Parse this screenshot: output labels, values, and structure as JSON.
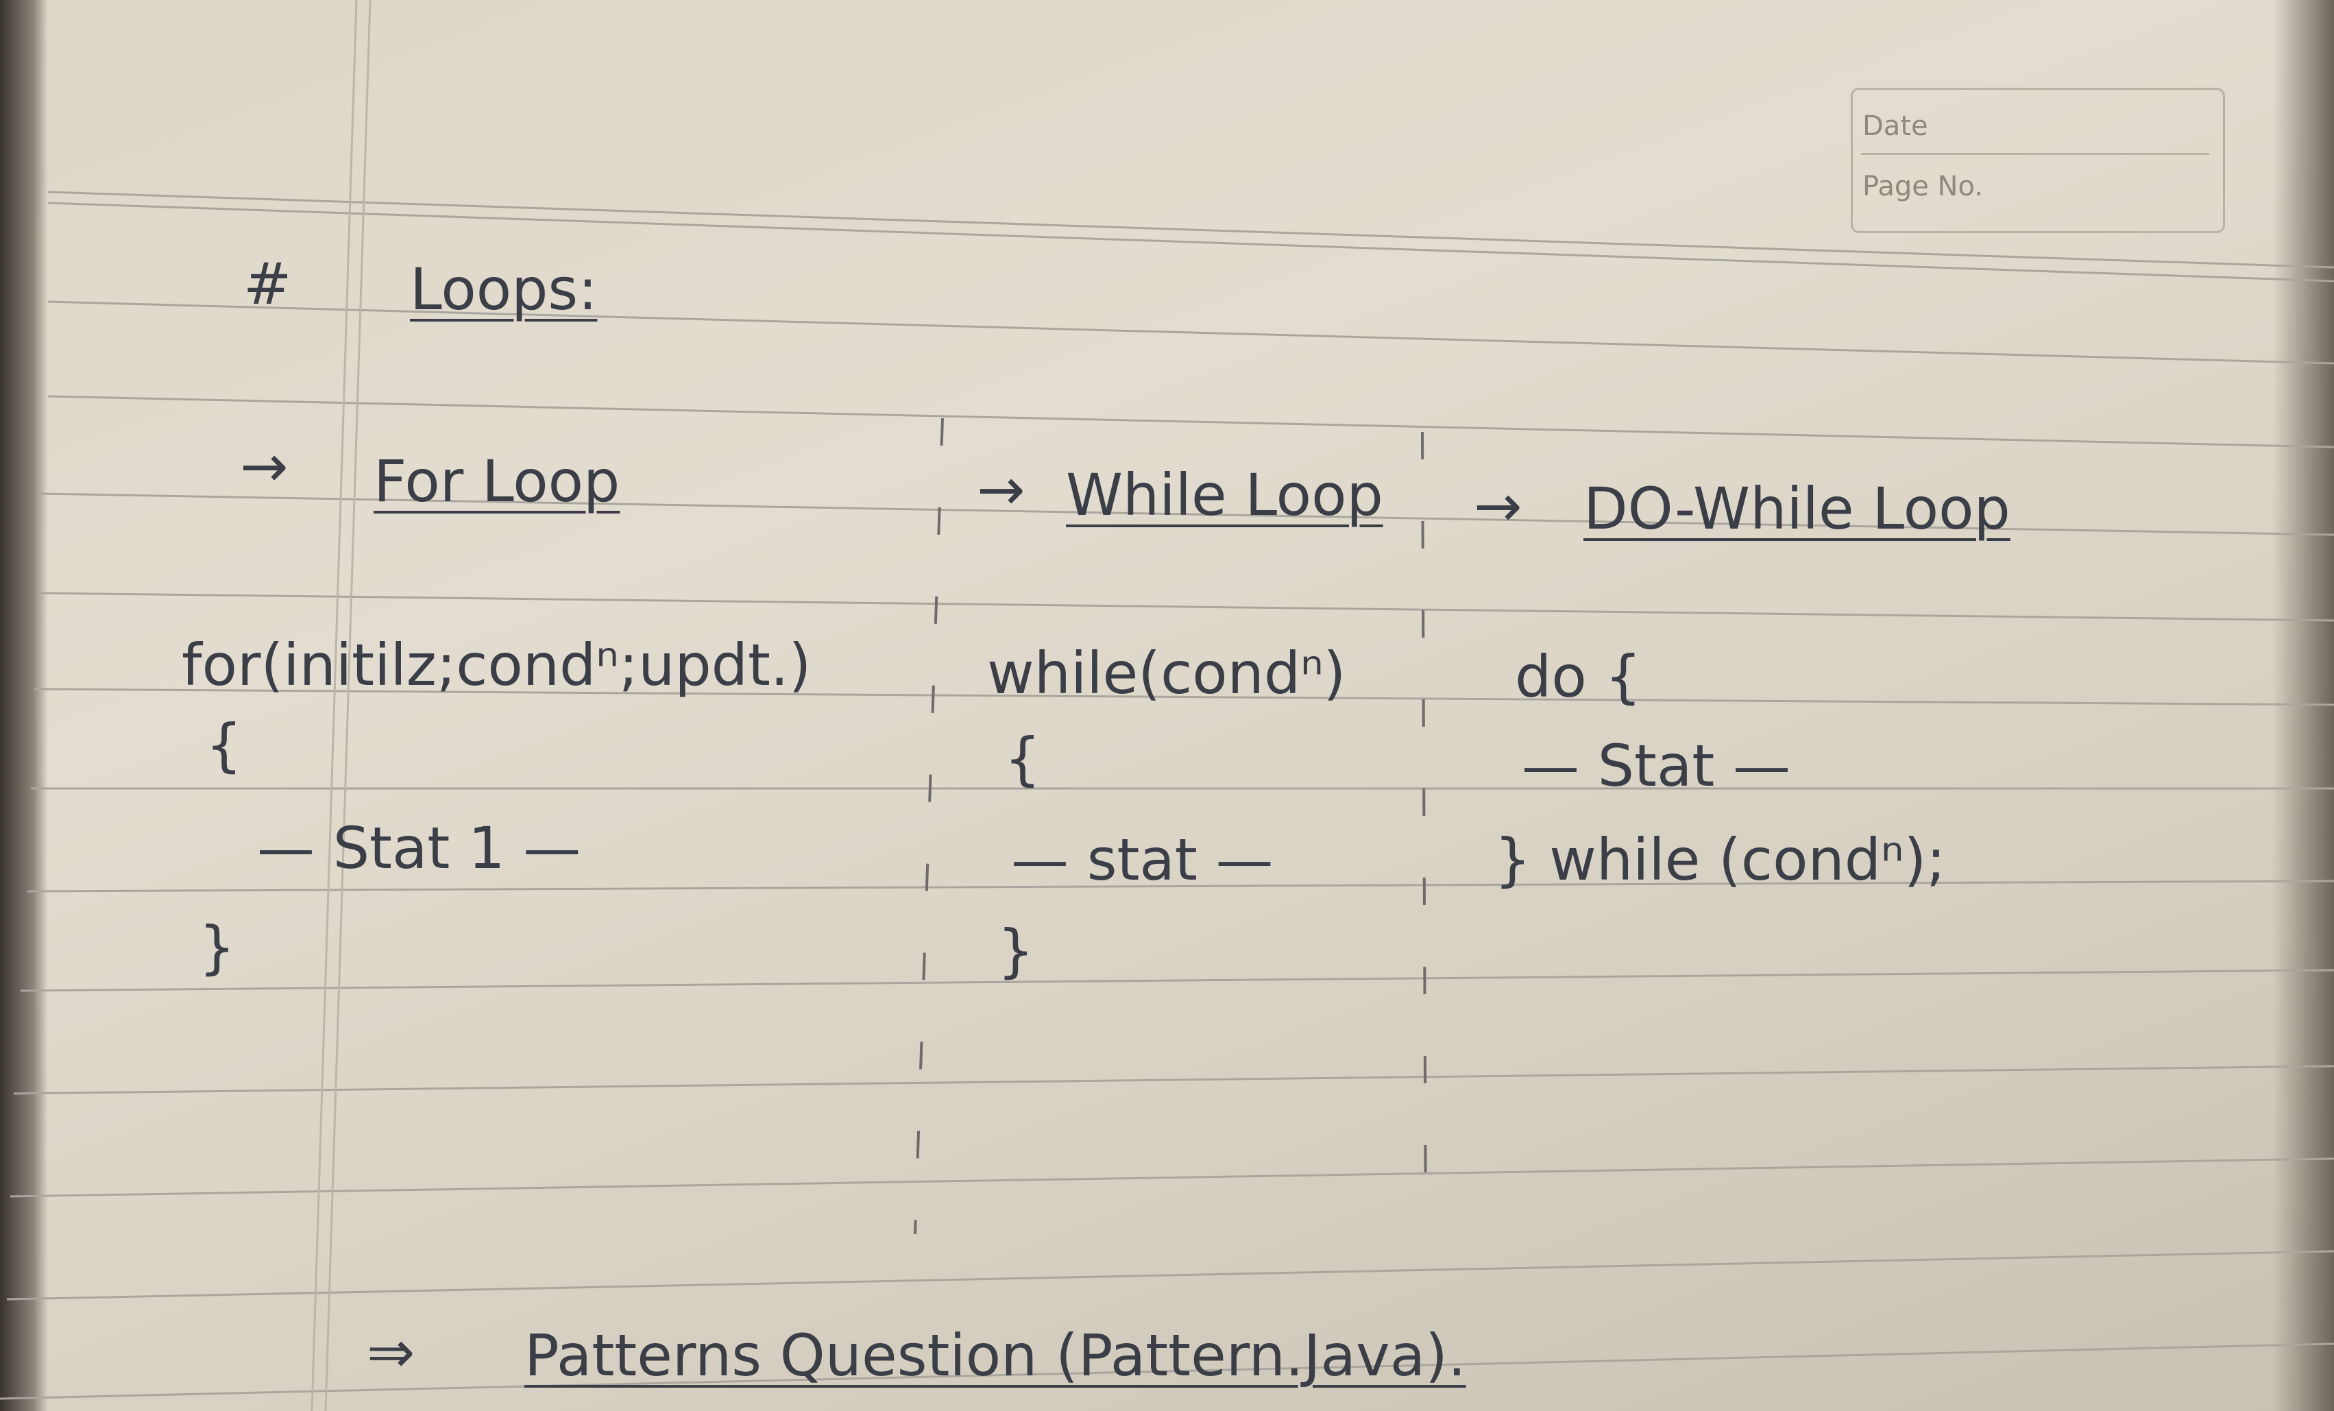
{
  "header": {
    "date_label": "Date",
    "page_no_label": "Page No."
  },
  "notes": {
    "heading_hash": "#",
    "heading": "Loops:",
    "for_arrow": "→",
    "for_title": "For Loop",
    "while_arrow": "→",
    "while_title": "While Loop",
    "dowhile_arrow": "→",
    "dowhile_title": "DO-While Loop",
    "for_line1": "for(initilz;condⁿ;updt.)",
    "for_open_brace": "{",
    "for_stat": "— Stat 1 —",
    "for_close_brace": "}",
    "while_line1": "while(condⁿ)",
    "while_open_brace": "{",
    "while_stat": "— stat —",
    "while_close_brace": "}",
    "do_line1": "do {",
    "do_stat": "— Stat —",
    "do_end": "} while (condⁿ);",
    "pattern_arrow": "⇒",
    "pattern_text": "Patterns Question (Pattern.Java)."
  },
  "colors": {
    "paper": "#e0dbce",
    "rule_line": "#a9a69f",
    "margin_line": "#bcb6aa",
    "ink": "#3b3d47"
  }
}
